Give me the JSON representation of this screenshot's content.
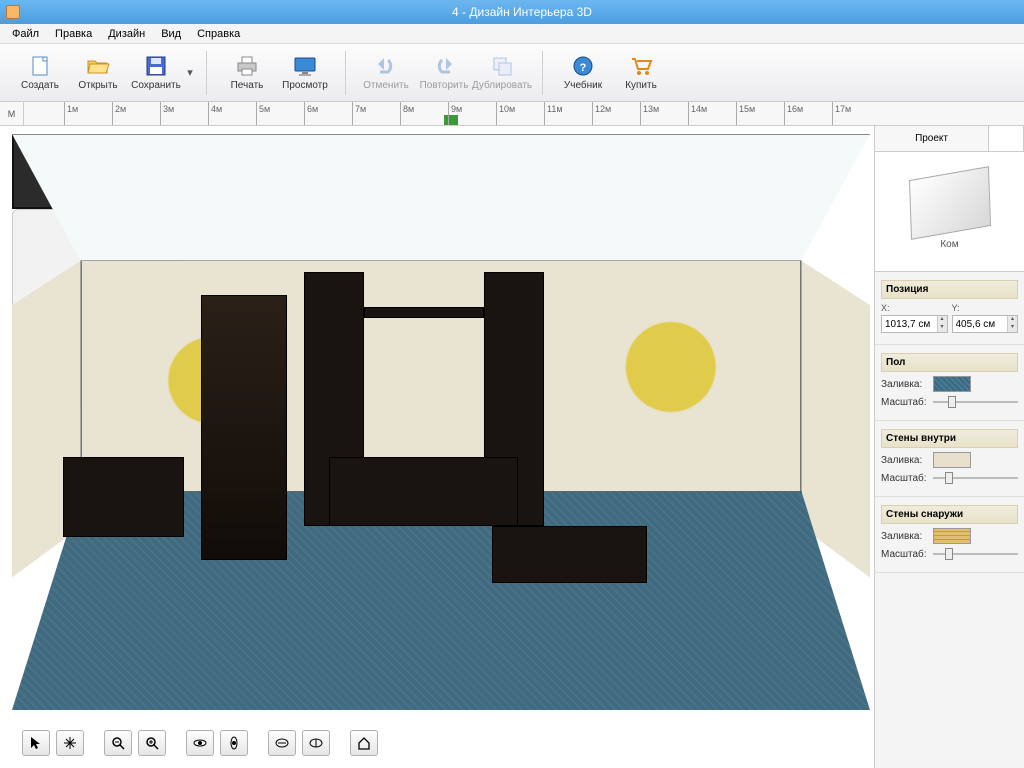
{
  "window": {
    "title": "4 - Дизайн Интерьера 3D"
  },
  "menu": {
    "file": "Файл",
    "edit": "Правка",
    "design": "Дизайн",
    "view": "Вид",
    "help": "Справка"
  },
  "toolbar": {
    "new": "Создать",
    "open": "Открыть",
    "save": "Сохранить",
    "print": "Печать",
    "preview": "Просмотр",
    "undo": "Отменить",
    "redo": "Повторить",
    "duplicate": "Дублировать",
    "manual": "Учебник",
    "buy": "Купить"
  },
  "ruler": {
    "unit": "M",
    "ticks": [
      "1м",
      "2м",
      "3м",
      "4м",
      "5м",
      "6м",
      "7м",
      "8м",
      "9м",
      "10м",
      "11м",
      "12м",
      "13м",
      "14м",
      "15м",
      "16м",
      "17м"
    ]
  },
  "side": {
    "tab_project": "Проект",
    "preview_label": "Ком",
    "sections": {
      "position": {
        "head": "Позиция",
        "x_label": "X:",
        "y_label": "Y:",
        "x": "1013,7 см",
        "y": "405,6 см"
      },
      "floor": {
        "head": "Пол",
        "fill_label": "Заливка:",
        "scale_label": "Масштаб:"
      },
      "walls_in": {
        "head": "Стены внутри",
        "fill_label": "Заливка:",
        "scale_label": "Масштаб:"
      },
      "walls_out": {
        "head": "Стены снаружи",
        "fill_label": "Заливка:",
        "scale_label": "Масштаб:"
      }
    }
  },
  "viewtools": {
    "pointer": "pointer",
    "pan": "pan",
    "zoom_out": "zoom-out",
    "zoom_in": "zoom-in",
    "orbit": "orbit",
    "look": "look",
    "walk": "walk",
    "fly": "fly",
    "home": "home"
  }
}
